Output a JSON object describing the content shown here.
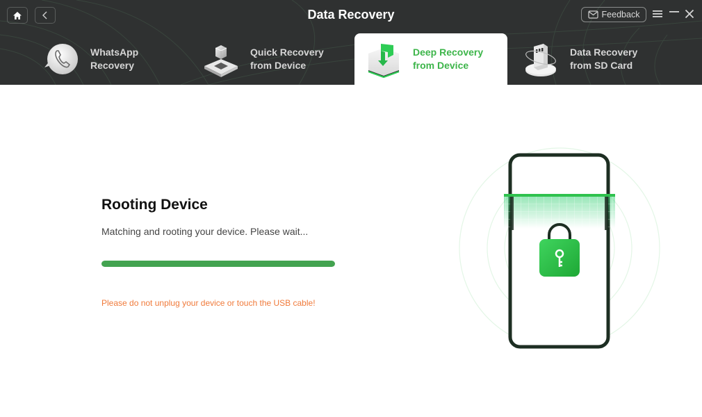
{
  "window": {
    "title": "Data Recovery",
    "feedback_label": "Feedback"
  },
  "icons": {
    "home": "home-icon",
    "back": "chevron-left-icon",
    "feedback": "mail-icon",
    "menu": "hamburger-menu-icon",
    "minimize": "minimize-icon",
    "close": "close-icon"
  },
  "tabs": [
    {
      "line1": "WhatsApp",
      "line2": "Recovery",
      "icon": "whatsapp-phone-icon",
      "active": false
    },
    {
      "line1": "Quick Recovery",
      "line2": "from Device",
      "icon": "device-cube-icon",
      "active": false
    },
    {
      "line1": "Deep Recovery",
      "line2": "from Device",
      "icon": "deep-recovery-box-icon",
      "active": true
    },
    {
      "line1": "Data Recovery",
      "line2": "from SD Card",
      "icon": "sd-card-icon",
      "active": false
    }
  ],
  "main": {
    "title": "Rooting Device",
    "subtitle": "Matching and rooting your device. Please wait...",
    "progress_percent": 100,
    "warning": "Please do not unplug your device or touch the USB cable!"
  },
  "colors": {
    "header_bg": "#2f3131",
    "accent_green": "#3db54a",
    "progress_green": "#43a350",
    "warning_orange": "#f07a3a",
    "phone_outline": "#1d2e22"
  }
}
